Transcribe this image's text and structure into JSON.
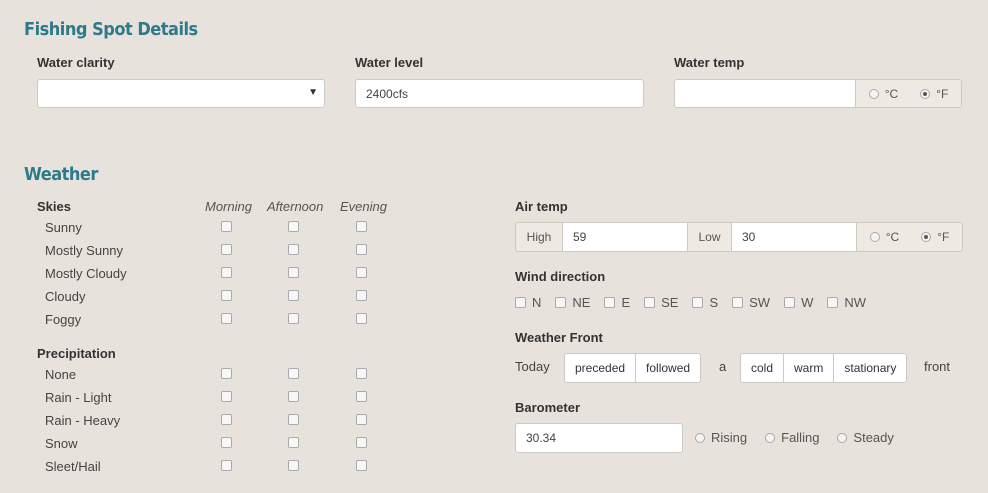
{
  "spot": {
    "title": "Fishing Spot Details",
    "water_clarity_label": "Water clarity",
    "water_clarity_value": "",
    "water_level_label": "Water level",
    "water_level_value": "2400cfs",
    "water_temp_label": "Water temp",
    "water_temp_value": "",
    "unit_c": "°C",
    "unit_f": "°F",
    "unit_selected": "°F"
  },
  "weather": {
    "title": "Weather",
    "skies_label": "Skies",
    "columns": [
      "Morning",
      "Afternoon",
      "Evening"
    ],
    "skies": [
      "Sunny",
      "Mostly Sunny",
      "Mostly Cloudy",
      "Cloudy",
      "Foggy"
    ],
    "precip_label": "Precipitation",
    "precipitation": [
      "None",
      "Rain - Light",
      "Rain - Heavy",
      "Snow",
      "Sleet/Hail"
    ],
    "air_temp_label": "Air temp",
    "high_label": "High",
    "high_value": "59",
    "low_label": "Low",
    "low_value": "30",
    "air_unit_c": "°C",
    "air_unit_f": "°F",
    "wind_label": "Wind direction",
    "wind": [
      "N",
      "NE",
      "E",
      "SE",
      "S",
      "SW",
      "W",
      "NW"
    ],
    "front_label": "Weather Front",
    "front_today": "Today",
    "front_opt1": "preceded",
    "front_opt2": "followed",
    "front_a": "a",
    "front_type1": "cold",
    "front_type2": "warm",
    "front_type3": "stationary",
    "front_word": "front",
    "baro_label": "Barometer",
    "baro_value": "30.34",
    "baro_rising": "Rising",
    "baro_falling": "Falling",
    "baro_steady": "Steady"
  }
}
